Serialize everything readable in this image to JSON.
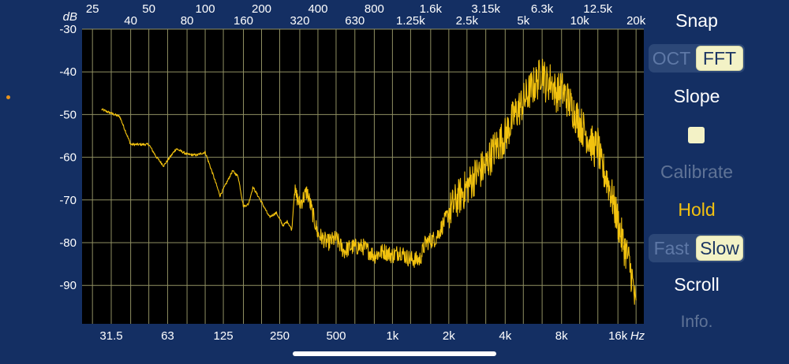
{
  "plot": {
    "db_unit": "dB",
    "hz_unit": "Hz",
    "db_ticks": [
      "-30",
      "-40",
      "-50",
      "-60",
      "-70",
      "-80",
      "-90"
    ],
    "top_freq_row1": [
      "25",
      "50",
      "100",
      "200",
      "400",
      "800",
      "1.6k",
      "3.15k",
      "6.3k",
      "12.5k"
    ],
    "top_freq_row2": [
      "40",
      "80",
      "160",
      "320",
      "630",
      "1.25k",
      "2.5k",
      "5k",
      "10k",
      "20k"
    ],
    "bottom_freq": [
      "31.5",
      "63",
      "125",
      "250",
      "500",
      "1k",
      "2k",
      "4k",
      "8k",
      "16k"
    ],
    "colors": {
      "background": "#142f63",
      "plot_bg": "#000000",
      "grid": "#8f8f62",
      "trace": "#f2c20f",
      "label": "#ffffff"
    }
  },
  "chart_data": {
    "type": "line",
    "title": "",
    "xlabel": "Hz",
    "ylabel": "dB",
    "x_scale": "log",
    "xlim": [
      22,
      22000
    ],
    "ylim": [
      -99,
      -30
    ],
    "grid": true,
    "series": [
      {
        "x": [
          28,
          35,
          40,
          50,
          55,
          60,
          70,
          80,
          90,
          100,
          110,
          120,
          130,
          140,
          150,
          160,
          170,
          180,
          200,
          220,
          240,
          260,
          275,
          290,
          300,
          320,
          350,
          400,
          450,
          500,
          550,
          600,
          700,
          800,
          900,
          1000,
          1100,
          1200,
          1300,
          1400,
          1500,
          1700,
          1800,
          2000,
          2200,
          2500,
          2800,
          3150,
          3500,
          4000,
          4500,
          5000,
          5500,
          6000,
          6300,
          6600,
          7000,
          7500,
          8000,
          8500,
          9000,
          9500,
          10000,
          11000,
          12000,
          12500,
          13000,
          14000,
          15000,
          16000,
          17000,
          18000,
          19000,
          19500,
          20000
        ],
        "y": [
          -48.8,
          -50.5,
          -57,
          -57,
          -60,
          -62,
          -58,
          -59.3,
          -59.5,
          -58.8,
          -64,
          -69,
          -66,
          -63.2,
          -64.5,
          -71.5,
          -71,
          -67,
          -70.5,
          -74,
          -73,
          -76,
          -75,
          -77,
          -68,
          -71,
          -68,
          -78,
          -80,
          -79,
          -82,
          -81,
          -81,
          -83,
          -82,
          -83,
          -82,
          -83.5,
          -84,
          -84,
          -80,
          -79,
          -77,
          -73,
          -70,
          -67,
          -64,
          -62,
          -58,
          -55,
          -50,
          -47,
          -44,
          -42,
          -39,
          -43,
          -42,
          -45,
          -44,
          -46,
          -48,
          -50,
          -52,
          -55,
          -58,
          -57,
          -62,
          -65,
          -70,
          -75,
          -80,
          -83,
          -88,
          -92,
          -96
        ]
      }
    ]
  },
  "sidebar": {
    "snap": "Snap",
    "oct": "OCT",
    "fft": "FFT",
    "slope": "Slope",
    "calibrate": "Calibrate",
    "hold": "Hold",
    "fast": "Fast",
    "slow": "Slow",
    "scroll": "Scroll",
    "info": "Info."
  }
}
